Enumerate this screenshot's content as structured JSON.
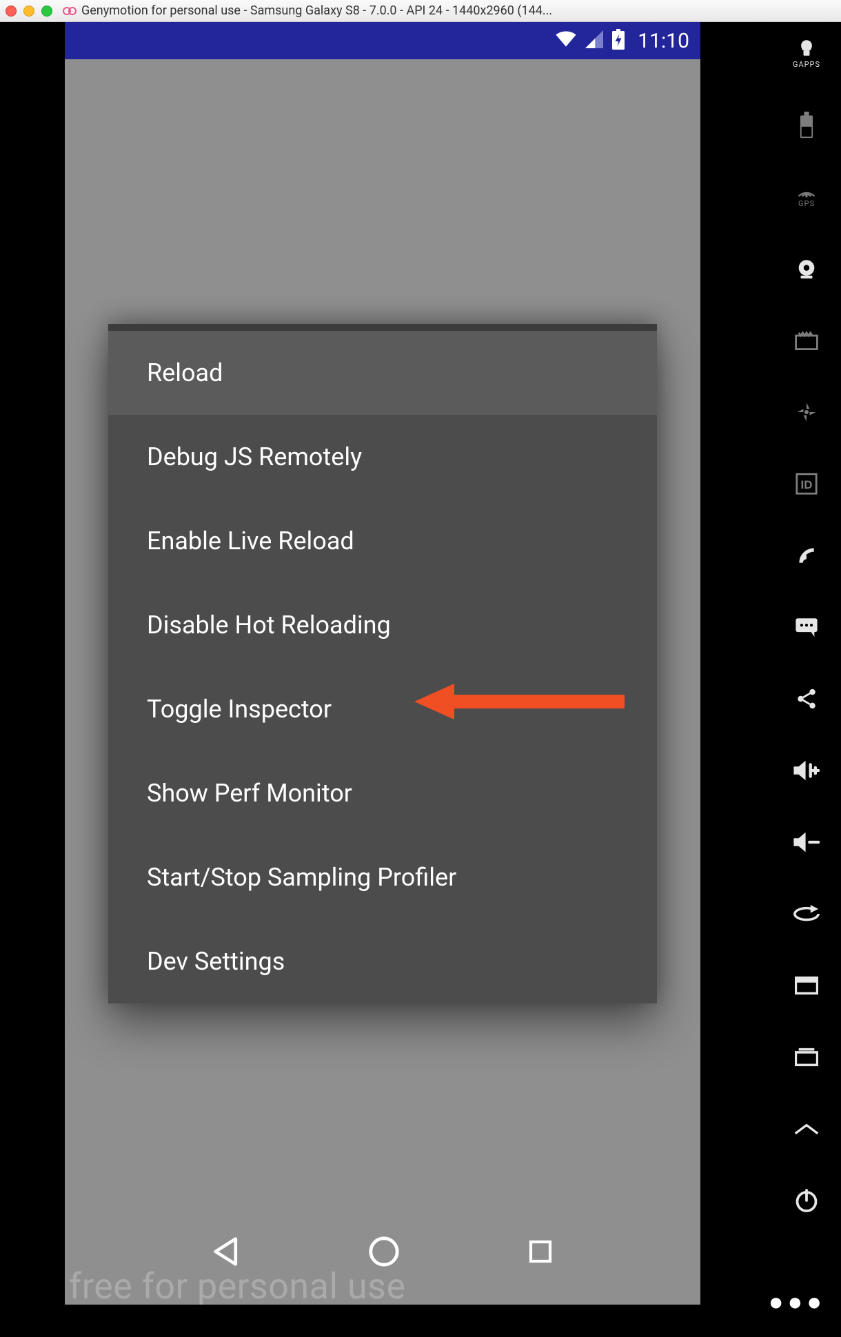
{
  "window": {
    "title": "Genymotion for personal use - Samsung Galaxy S8 - 7.0.0 - API 24 - 1440x2960 (144..."
  },
  "status_bar": {
    "time": "11:10"
  },
  "dev_menu": {
    "items": [
      {
        "label": "Reload",
        "highlight": true
      },
      {
        "label": "Debug JS Remotely",
        "highlight": false
      },
      {
        "label": "Enable Live Reload",
        "highlight": false
      },
      {
        "label": "Disable Hot Reloading",
        "highlight": false
      },
      {
        "label": "Toggle Inspector",
        "highlight": false
      },
      {
        "label": "Show Perf Monitor",
        "highlight": false
      },
      {
        "label": "Start/Stop Sampling Profiler",
        "highlight": false
      },
      {
        "label": "Dev Settings",
        "highlight": false
      }
    ]
  },
  "annotation": {
    "target_label": "Toggle Inspector"
  },
  "right_rail": {
    "gapps_label": "GAPPS",
    "gps_label": "GPS"
  },
  "watermark": "free for personal use"
}
